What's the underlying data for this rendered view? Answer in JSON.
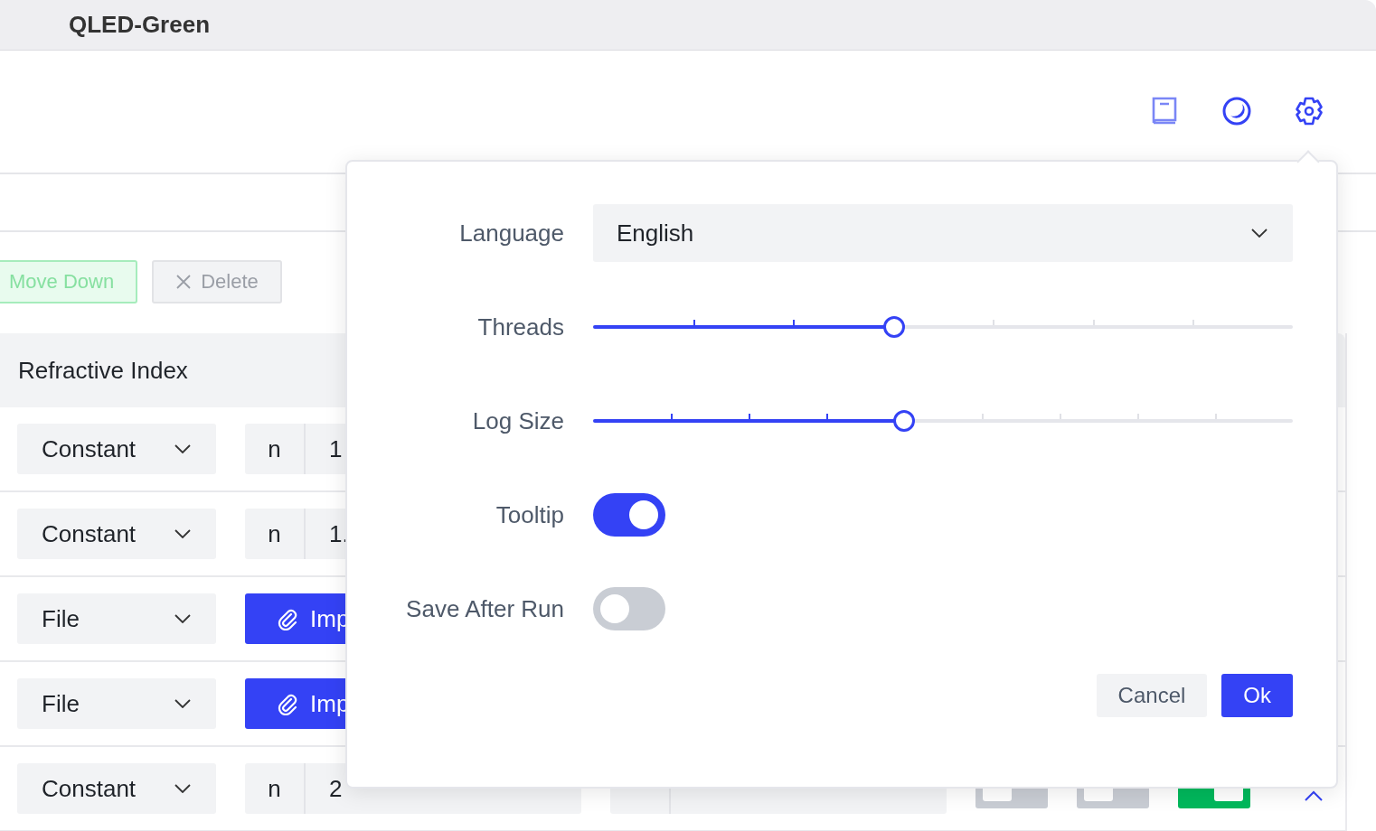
{
  "window": {
    "title": "QLED-Green"
  },
  "toolbar": {
    "buttons": [
      {
        "label": "Move Down",
        "kind": "move",
        "disabled": true
      },
      {
        "label": "Delete",
        "kind": "delete",
        "disabled": true
      }
    ]
  },
  "refractive_index": {
    "title": "Refractive Index",
    "rows": [
      {
        "kind": "constant",
        "source": "Constant",
        "n_label": "n",
        "n_value": "1"
      },
      {
        "kind": "constant",
        "source": "Constant",
        "n_label": "n",
        "n_value": "1."
      },
      {
        "kind": "file",
        "source": "File",
        "button": "Imp"
      },
      {
        "kind": "file",
        "source": "File",
        "button": "Imp"
      },
      {
        "kind": "constant_nk",
        "source": "Constant",
        "n_label": "n",
        "n_value": "2",
        "switches": [
          {
            "on": false
          },
          {
            "on": false
          },
          {
            "on": true
          }
        ]
      }
    ]
  },
  "settings": {
    "fields": [
      {
        "kind": "select",
        "label": "Language",
        "value": "English"
      },
      {
        "kind": "slider",
        "label": "Threads",
        "level": 0.43
      },
      {
        "kind": "slider",
        "label": "Log Size",
        "level": 0.444
      },
      {
        "kind": "toggle",
        "label": "Tooltip",
        "on": true
      },
      {
        "kind": "toggle",
        "label": "Save After Run",
        "on": false
      }
    ],
    "buttons": [
      {
        "label": "Cancel",
        "kind": "secondary"
      },
      {
        "label": "Ok",
        "kind": "primary"
      }
    ]
  }
}
